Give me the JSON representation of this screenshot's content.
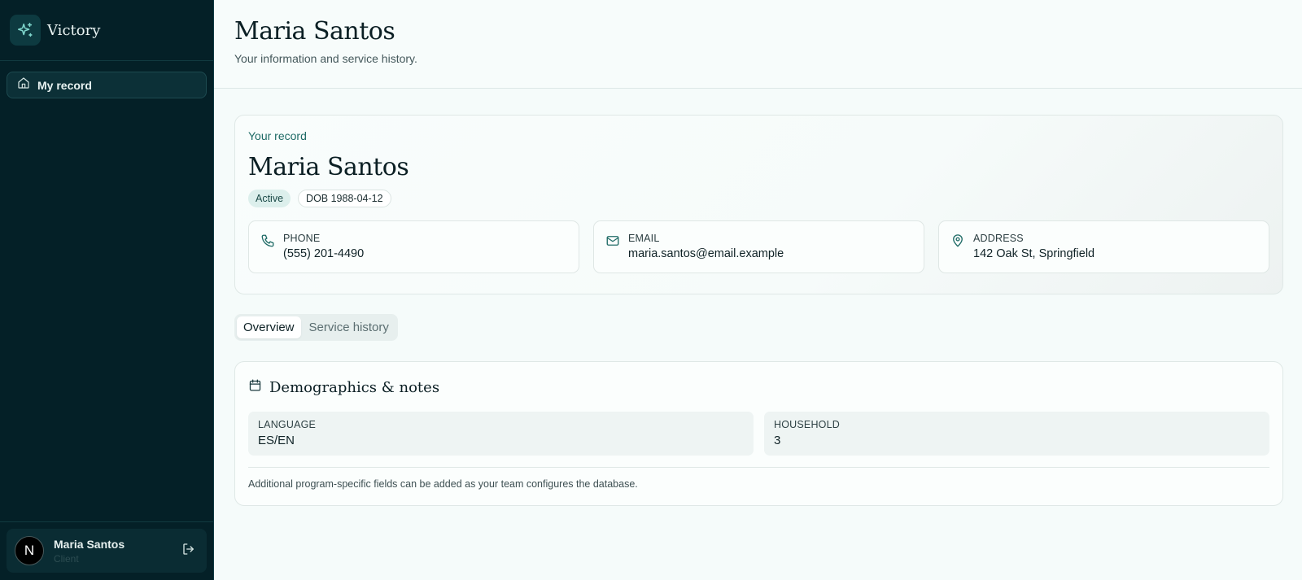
{
  "sidebar": {
    "brand_name": "Victory",
    "nav": [
      {
        "label": "My record",
        "icon": "home-icon"
      }
    ],
    "user": {
      "initial": "N",
      "name": "Maria Santos",
      "role": "Client"
    }
  },
  "header": {
    "title": "Maria Santos",
    "subtitle": "Your information and service history."
  },
  "record": {
    "eyebrow": "Your record",
    "name": "Maria Santos",
    "status_badge": "Active",
    "dob_badge": "DOB 1988-04-12",
    "contacts": [
      {
        "label": "PHONE",
        "value": "(555) 201-4490",
        "icon": "phone-icon"
      },
      {
        "label": "EMAIL",
        "value": "maria.santos@email.example",
        "icon": "mail-icon"
      },
      {
        "label": "ADDRESS",
        "value": "142 Oak St, Springfield",
        "icon": "map-pin-icon"
      }
    ]
  },
  "tabs": [
    {
      "label": "Overview",
      "active": true
    },
    {
      "label": "Service history",
      "active": false
    }
  ],
  "demographics": {
    "title": "Demographics & notes",
    "fields": [
      {
        "label": "LANGUAGE",
        "value": "ES/EN"
      },
      {
        "label": "HOUSEHOLD",
        "value": "3"
      }
    ],
    "note": "Additional program-specific fields can be added as your team configures the database."
  },
  "colors": {
    "sidebar_bg": "#042027",
    "accent": "#1f6b66",
    "page_bg": "#f5fbfa"
  }
}
